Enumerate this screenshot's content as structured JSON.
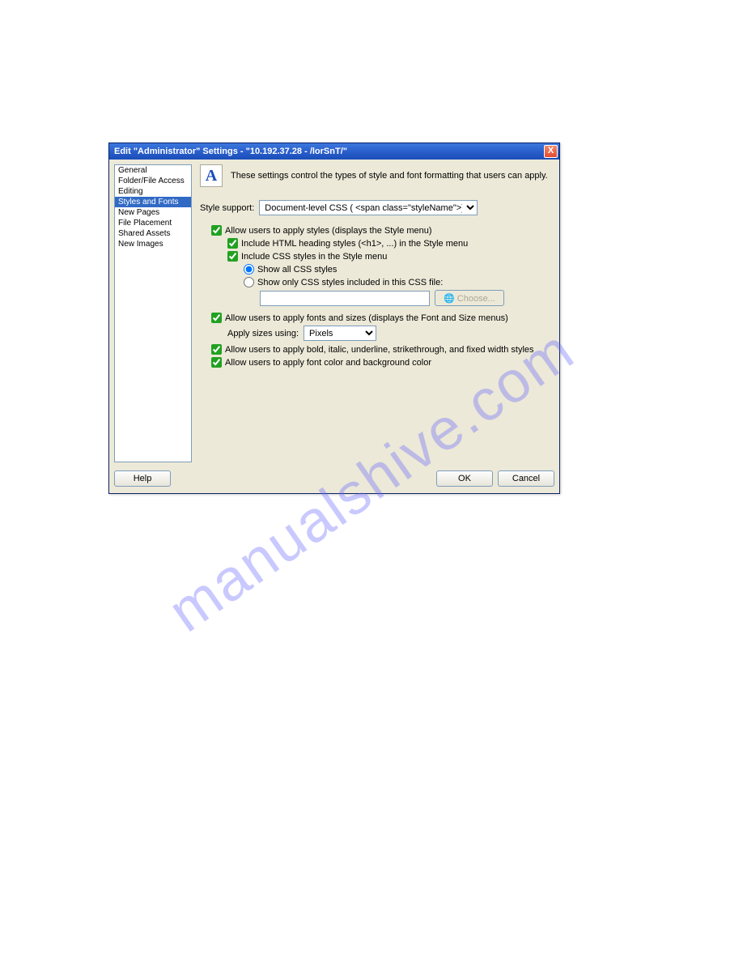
{
  "titlebar": {
    "text": "Edit \"Administrator\" Settings - \"10.192.37.28 - /lorSnT/\"",
    "close": "X"
  },
  "sidebar": {
    "items": [
      {
        "label": "General",
        "selected": false
      },
      {
        "label": "Folder/File Access",
        "selected": false
      },
      {
        "label": "Editing",
        "selected": false
      },
      {
        "label": "Styles and Fonts",
        "selected": true
      },
      {
        "label": "New Pages",
        "selected": false
      },
      {
        "label": "File Placement",
        "selected": false
      },
      {
        "label": "Shared Assets",
        "selected": false
      },
      {
        "label": "New Images",
        "selected": false
      }
    ]
  },
  "header": {
    "icon": "A",
    "desc": "These settings control the types of style and font formatting that users can apply."
  },
  "style_support": {
    "label": "Style support:",
    "value": "Document-level CSS ( <span class=\"styleName\">)"
  },
  "opts": {
    "apply_styles": "Allow users to apply styles (displays the Style menu)",
    "include_headings": "Include HTML heading styles (<h1>, ...) in the Style menu",
    "include_css": "Include CSS styles in the Style menu",
    "show_all": "Show all CSS styles",
    "show_only": "Show only CSS styles included in this CSS file:",
    "choose": "Choose...",
    "apply_fonts": "Allow users to apply fonts and sizes (displays the Font and Size menus)",
    "apply_sizes_label": "Apply sizes using:",
    "apply_sizes_value": "Pixels",
    "apply_bold": "Allow users to apply bold, italic, underline, strikethrough, and fixed width styles",
    "apply_color": "Allow users to apply font color and background color"
  },
  "footer": {
    "help": "Help",
    "ok": "OK",
    "cancel": "Cancel"
  },
  "watermark": "manualshive.com"
}
